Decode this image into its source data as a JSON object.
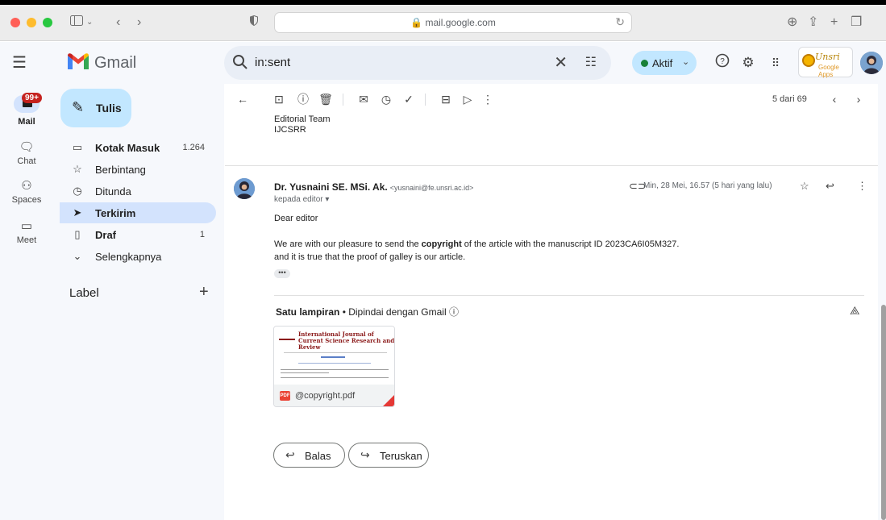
{
  "browser": {
    "url": "mail.google.com"
  },
  "app": {
    "name": "Gmail"
  },
  "search": {
    "query": "in:sent"
  },
  "status": {
    "label": "Aktif"
  },
  "rail": {
    "mail_label": "Mail",
    "badge": "99+",
    "chat_label": "Chat",
    "spaces_label": "Spaces",
    "meet_label": "Meet"
  },
  "compose": {
    "label": "Tulis"
  },
  "nav": {
    "items": [
      {
        "label": "Kotak Masuk",
        "count": "1.264",
        "icon": "inbox-icon"
      },
      {
        "label": "Berbintang",
        "count": "",
        "icon": "star-icon"
      },
      {
        "label": "Ditunda",
        "count": "",
        "icon": "clock-icon"
      },
      {
        "label": "Terkirim",
        "count": "",
        "icon": "send-icon"
      },
      {
        "label": "Draf",
        "count": "1",
        "icon": "draft-icon"
      },
      {
        "label": "Selengkapnya",
        "count": "",
        "icon": "chevron-down-icon"
      }
    ],
    "label_heading": "Label"
  },
  "toolbar": {
    "page_count": "5 dari 69"
  },
  "previous_message": {
    "line1": "Editorial Team",
    "line2": "IJCSRR"
  },
  "message": {
    "sender_name": "Dr. Yusnaini SE. MSi. Ak.",
    "sender_email": "<yusnaini@fe.unsri.ac.id>",
    "recipient": "kepada editor",
    "date": "Min, 28 Mei, 16.57 (5 hari yang lalu)",
    "greeting": "Dear editor",
    "body_prefix": "We are with our pleasure to send the ",
    "body_bold": "copyright",
    "body_suffix": " of the article with the manuscript ID 2023CA6I05M327.",
    "body_line2": "and it is true that the proof of galley is our article.",
    "ellipsis": "•••"
  },
  "attachments": {
    "heading_bold": "Satu lampiran",
    "heading_rest": " • Dipindai dengan Gmail ⓘ",
    "file": {
      "name": "@copyright.pdf",
      "type_badge": "PDF",
      "preview_title": "International Journal of Current Science Research and Review"
    }
  },
  "actions": {
    "reply_label": "Balas",
    "forward_label": "Teruskan"
  },
  "org_logo": {
    "text": "Unsri",
    "sub": "Google Apps"
  }
}
